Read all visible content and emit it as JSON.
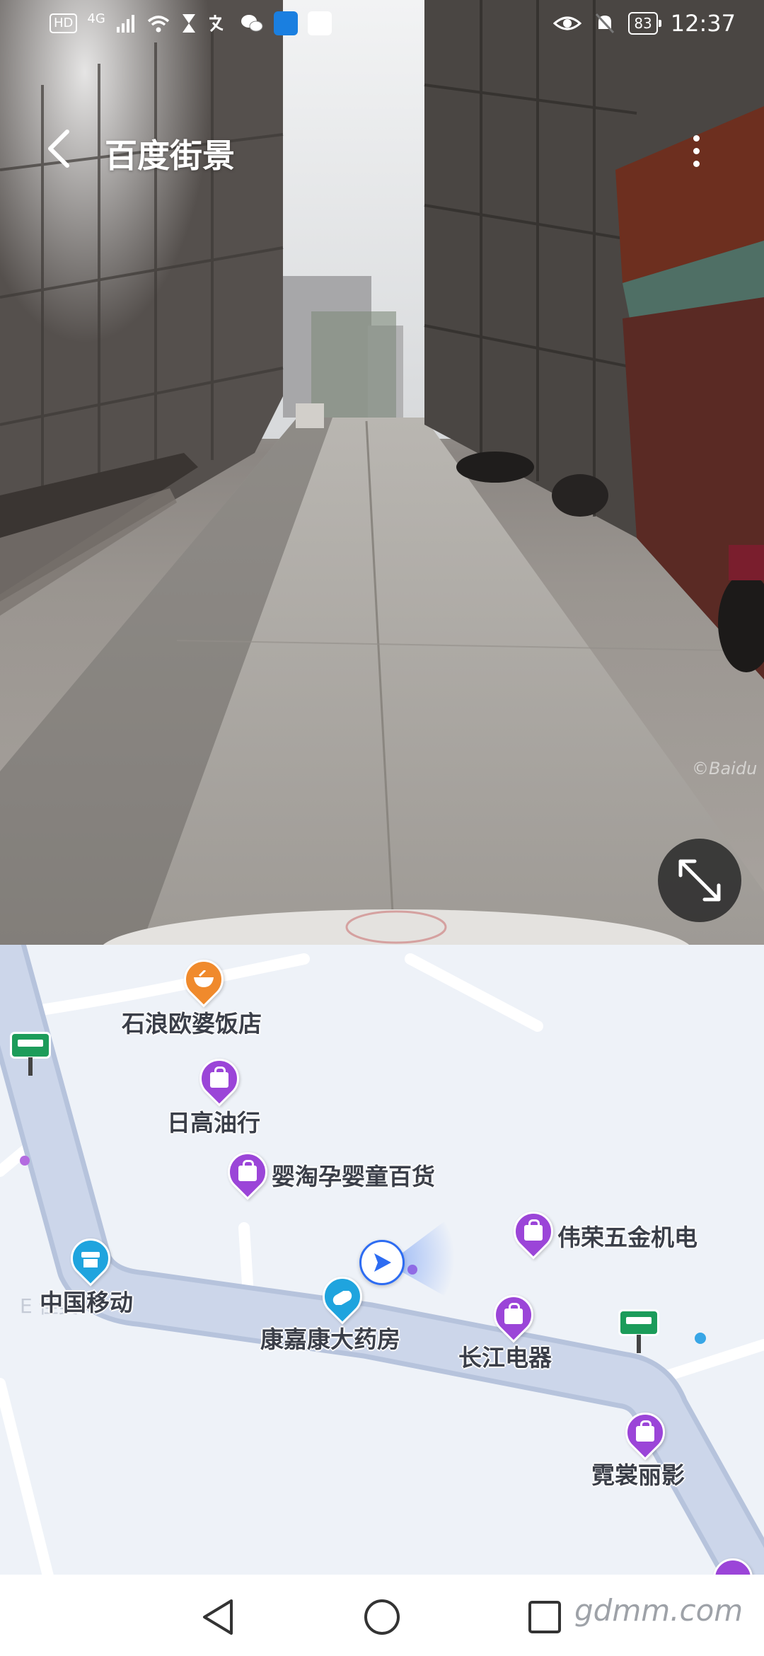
{
  "status_bar": {
    "left_badges": [
      "HD",
      "4G"
    ],
    "battery": "83",
    "time": "12:37"
  },
  "header": {
    "title": "百度街景"
  },
  "streetview": {
    "watermark": "©Baidu"
  },
  "map": {
    "pois": [
      {
        "name": "石浪欧婆饭店",
        "category": "restaurant",
        "icon": "bowl-icon",
        "color": "#f08a2c"
      },
      {
        "name": "日高油行",
        "category": "shopping",
        "icon": "shopping-bag-icon",
        "color": "#9b45d8"
      },
      {
        "name": "婴淘孕婴童百货",
        "category": "shopping",
        "icon": "shopping-bag-icon",
        "color": "#9b45d8"
      },
      {
        "name": "伟荣五金机电",
        "category": "shopping",
        "icon": "shopping-bag-icon",
        "color": "#9b45d8"
      },
      {
        "name": "中国移动",
        "category": "service",
        "icon": "store-icon",
        "color": "#1fa4de"
      },
      {
        "name": "康嘉康大药房",
        "category": "pharmacy",
        "icon": "pill-icon",
        "color": "#1fa4de"
      },
      {
        "name": "长江电器",
        "category": "shopping",
        "icon": "shopping-bag-icon",
        "color": "#9b45d8"
      },
      {
        "name": "霓裳丽影",
        "category": "shopping",
        "icon": "shopping-bag-icon",
        "color": "#9b45d8"
      }
    ],
    "faded_label": "E        佳美"
  },
  "navbar": {
    "watermark": "gdmm.com"
  },
  "colors": {
    "route": "#ccd6ea",
    "route_edge": "#b6c3dc",
    "map_bg": "#eef2f8",
    "nav_blue": "#2d6cf2"
  }
}
